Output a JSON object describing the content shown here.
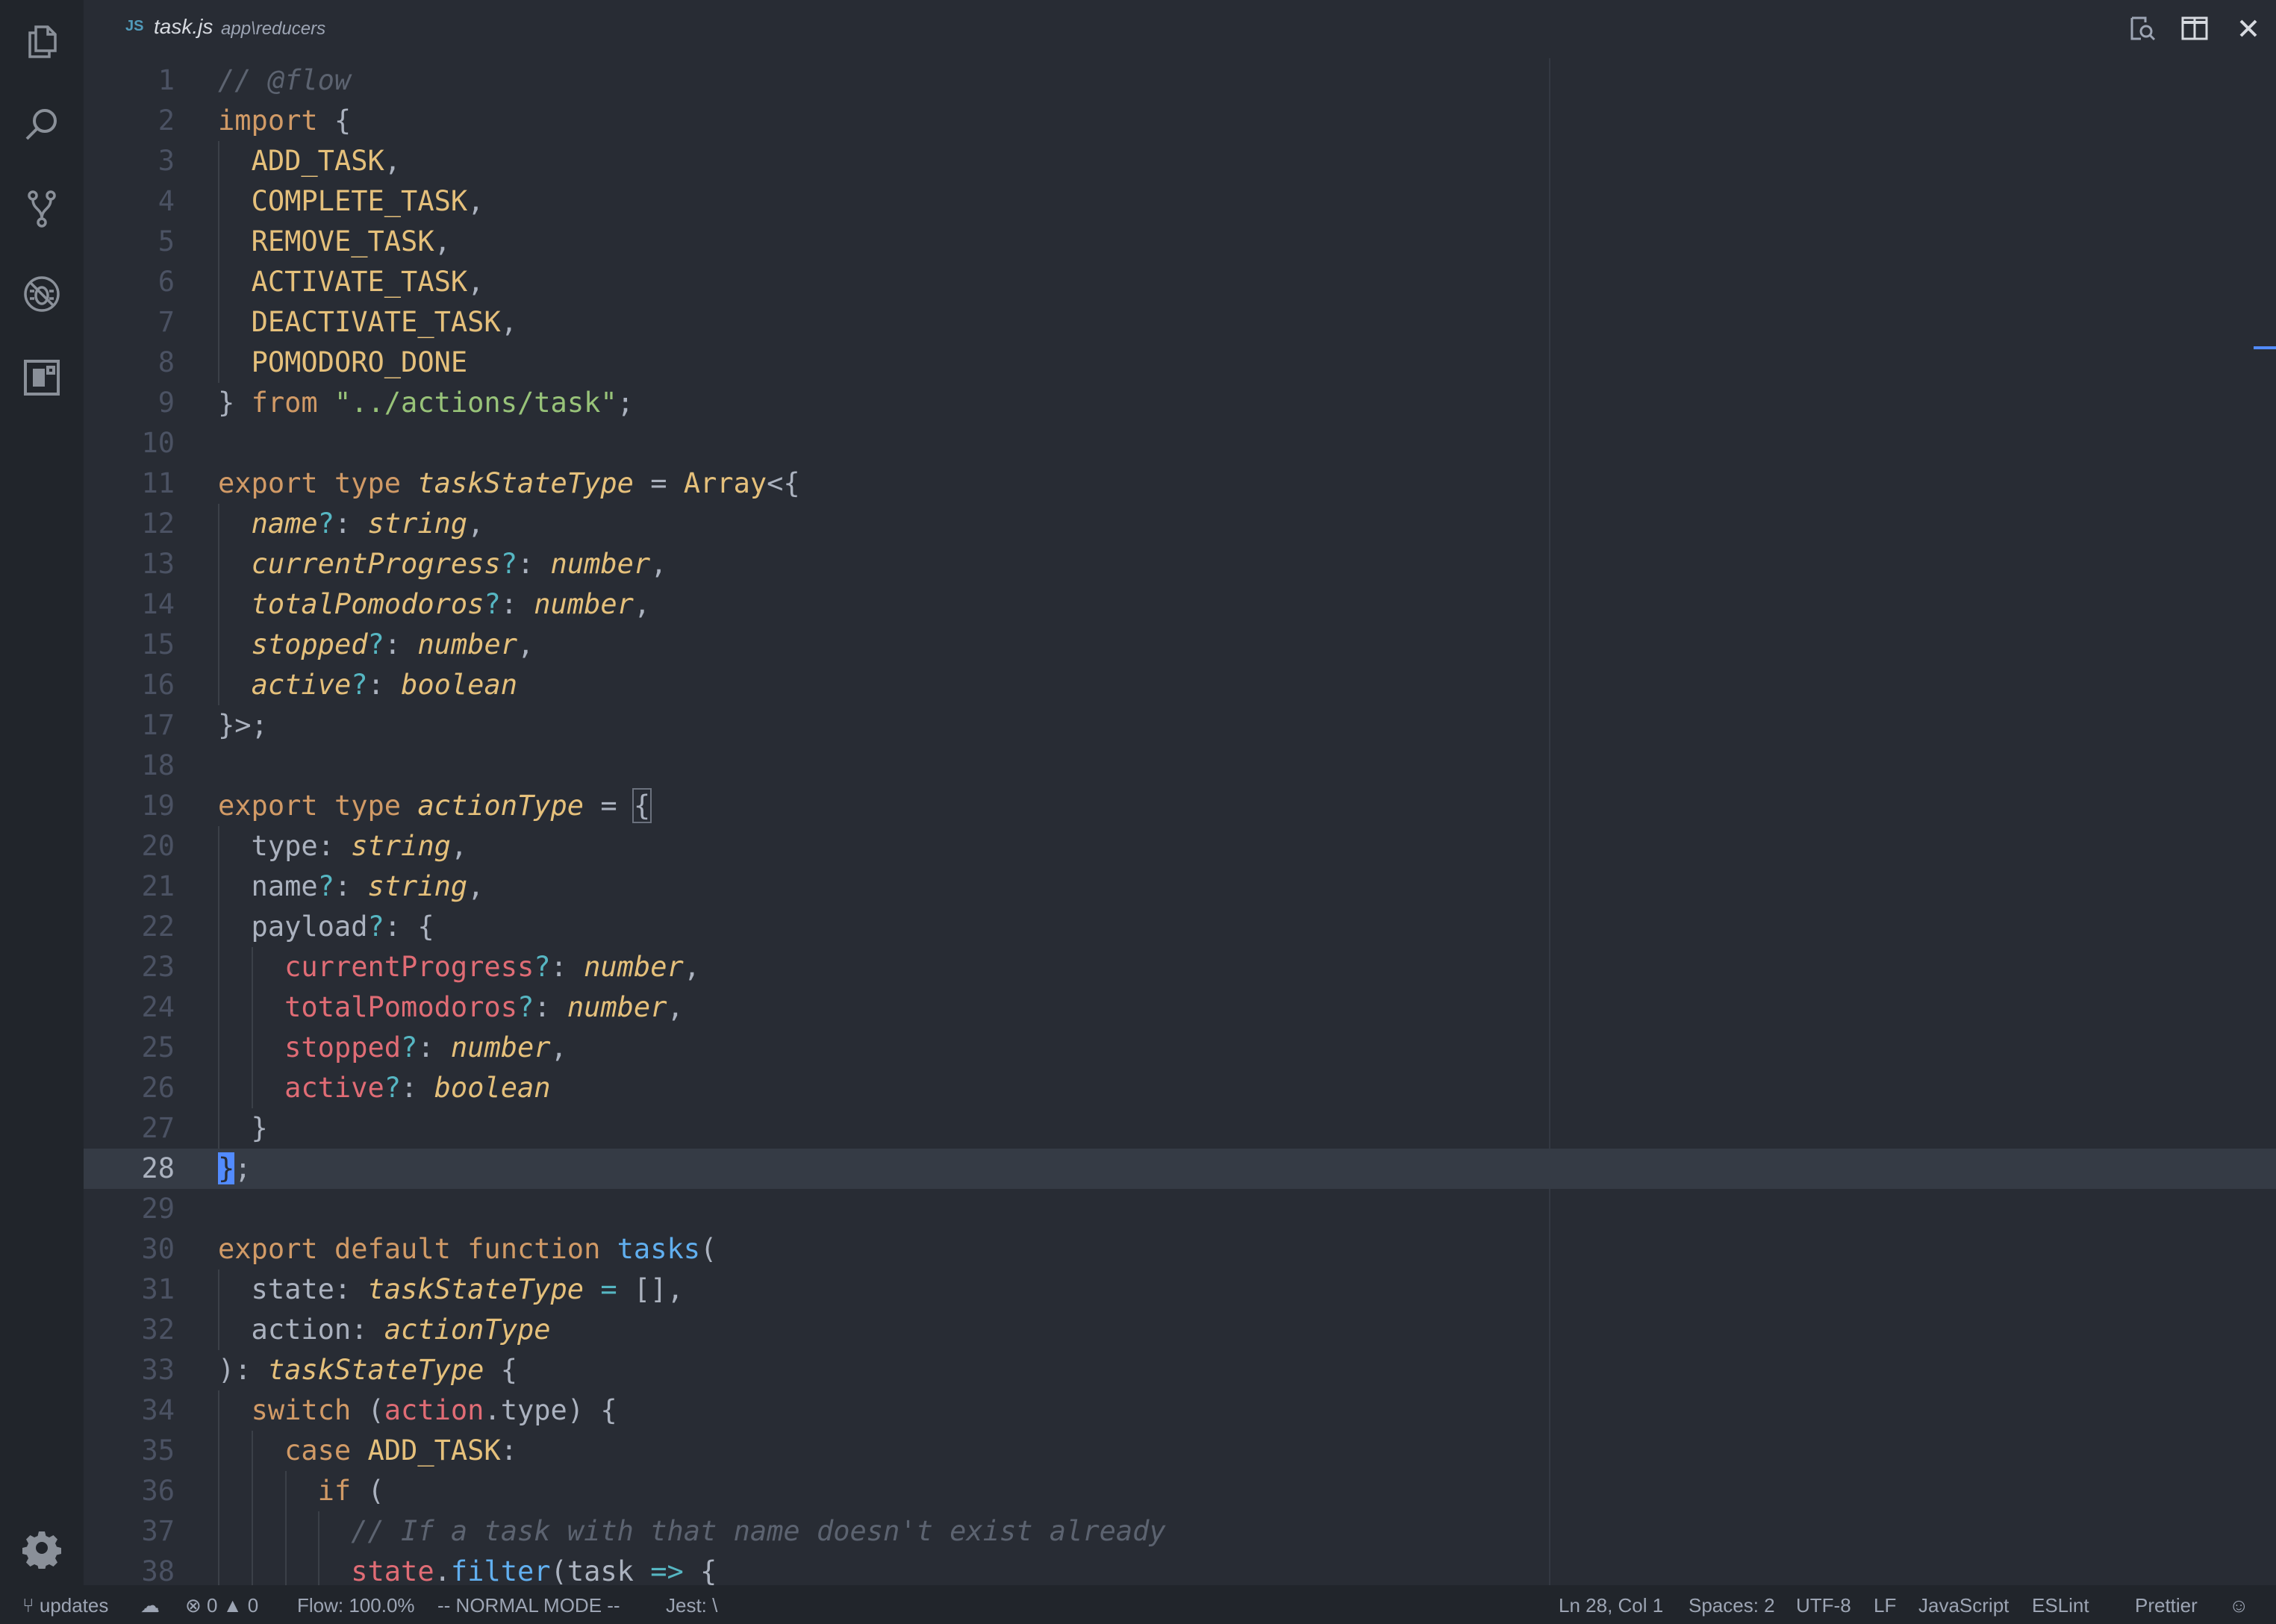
{
  "activity_bar": {
    "icons": [
      "files-icon",
      "search-icon",
      "source-control-icon",
      "debug-icon",
      "extensions-icon",
      "gear-icon"
    ]
  },
  "tab": {
    "language_badge": "JS",
    "filename": "task.js",
    "path": "app\\reducers"
  },
  "title_actions": [
    "open-preview-icon",
    "split-editor-icon",
    "close-icon"
  ],
  "editor": {
    "current_line": 28,
    "lines": [
      {
        "n": "1",
        "tokens": [
          {
            "t": "// @flow",
            "c": "comment"
          }
        ]
      },
      {
        "n": "2",
        "tokens": [
          {
            "t": "import",
            "c": "kw"
          },
          {
            "t": " {",
            "c": "plain"
          }
        ]
      },
      {
        "n": "3",
        "tokens": [
          {
            "t": "  ",
            "c": "plain"
          },
          {
            "t": "ADD_TASK",
            "c": "const"
          },
          {
            "t": ",",
            "c": "plain"
          }
        ]
      },
      {
        "n": "4",
        "tokens": [
          {
            "t": "  ",
            "c": "plain"
          },
          {
            "t": "COMPLETE_TASK",
            "c": "const"
          },
          {
            "t": ",",
            "c": "plain"
          }
        ]
      },
      {
        "n": "5",
        "tokens": [
          {
            "t": "  ",
            "c": "plain"
          },
          {
            "t": "REMOVE_TASK",
            "c": "const"
          },
          {
            "t": ",",
            "c": "plain"
          }
        ]
      },
      {
        "n": "6",
        "tokens": [
          {
            "t": "  ",
            "c": "plain"
          },
          {
            "t": "ACTIVATE_TASK",
            "c": "const"
          },
          {
            "t": ",",
            "c": "plain"
          }
        ]
      },
      {
        "n": "7",
        "tokens": [
          {
            "t": "  ",
            "c": "plain"
          },
          {
            "t": "DEACTIVATE_TASK",
            "c": "const"
          },
          {
            "t": ",",
            "c": "plain"
          }
        ]
      },
      {
        "n": "8",
        "tokens": [
          {
            "t": "  ",
            "c": "plain"
          },
          {
            "t": "POMODORO_DONE",
            "c": "const"
          }
        ]
      },
      {
        "n": "9",
        "tokens": [
          {
            "t": "} ",
            "c": "plain"
          },
          {
            "t": "from",
            "c": "kw"
          },
          {
            "t": " ",
            "c": "plain"
          },
          {
            "t": "\"../actions/task\"",
            "c": "str"
          },
          {
            "t": ";",
            "c": "plain"
          }
        ]
      },
      {
        "n": "10",
        "tokens": []
      },
      {
        "n": "11",
        "tokens": [
          {
            "t": "export",
            "c": "kw"
          },
          {
            "t": " ",
            "c": "plain"
          },
          {
            "t": "type",
            "c": "kw"
          },
          {
            "t": " ",
            "c": "plain"
          },
          {
            "t": "taskStateType",
            "c": "type"
          },
          {
            "t": " = ",
            "c": "plain"
          },
          {
            "t": "Array",
            "c": "const"
          },
          {
            "t": "<{",
            "c": "plain"
          }
        ]
      },
      {
        "n": "12",
        "tokens": [
          {
            "t": "  ",
            "c": "plain"
          },
          {
            "t": "name",
            "c": "prop"
          },
          {
            "t": "?",
            "c": "opt"
          },
          {
            "t": ": ",
            "c": "plain"
          },
          {
            "t": "string",
            "c": "type"
          },
          {
            "t": ",",
            "c": "plain"
          }
        ]
      },
      {
        "n": "13",
        "tokens": [
          {
            "t": "  ",
            "c": "plain"
          },
          {
            "t": "currentProgress",
            "c": "prop"
          },
          {
            "t": "?",
            "c": "opt"
          },
          {
            "t": ": ",
            "c": "plain"
          },
          {
            "t": "number",
            "c": "type"
          },
          {
            "t": ",",
            "c": "plain"
          }
        ]
      },
      {
        "n": "14",
        "tokens": [
          {
            "t": "  ",
            "c": "plain"
          },
          {
            "t": "totalPomodoros",
            "c": "prop"
          },
          {
            "t": "?",
            "c": "opt"
          },
          {
            "t": ": ",
            "c": "plain"
          },
          {
            "t": "number",
            "c": "type"
          },
          {
            "t": ",",
            "c": "plain"
          }
        ]
      },
      {
        "n": "15",
        "tokens": [
          {
            "t": "  ",
            "c": "plain"
          },
          {
            "t": "stopped",
            "c": "prop"
          },
          {
            "t": "?",
            "c": "opt"
          },
          {
            "t": ": ",
            "c": "plain"
          },
          {
            "t": "number",
            "c": "type"
          },
          {
            "t": ",",
            "c": "plain"
          }
        ]
      },
      {
        "n": "16",
        "tokens": [
          {
            "t": "  ",
            "c": "plain"
          },
          {
            "t": "active",
            "c": "prop"
          },
          {
            "t": "?",
            "c": "opt"
          },
          {
            "t": ": ",
            "c": "plain"
          },
          {
            "t": "boolean",
            "c": "type"
          }
        ]
      },
      {
        "n": "17",
        "tokens": [
          {
            "t": "}>;",
            "c": "plain"
          }
        ]
      },
      {
        "n": "18",
        "tokens": []
      },
      {
        "n": "19",
        "tokens": [
          {
            "t": "export",
            "c": "kw"
          },
          {
            "t": " ",
            "c": "plain"
          },
          {
            "t": "type",
            "c": "kw"
          },
          {
            "t": " ",
            "c": "plain"
          },
          {
            "t": "actionType",
            "c": "type"
          },
          {
            "t": " = ",
            "c": "plain"
          },
          {
            "t": "{",
            "c": "bracket"
          }
        ]
      },
      {
        "n": "20",
        "tokens": [
          {
            "t": "  type: ",
            "c": "plain"
          },
          {
            "t": "string",
            "c": "type"
          },
          {
            "t": ",",
            "c": "plain"
          }
        ]
      },
      {
        "n": "21",
        "tokens": [
          {
            "t": "  name",
            "c": "plain"
          },
          {
            "t": "?",
            "c": "opt"
          },
          {
            "t": ": ",
            "c": "plain"
          },
          {
            "t": "string",
            "c": "type"
          },
          {
            "t": ",",
            "c": "plain"
          }
        ]
      },
      {
        "n": "22",
        "tokens": [
          {
            "t": "  payload",
            "c": "plain"
          },
          {
            "t": "?",
            "c": "opt"
          },
          {
            "t": ": {",
            "c": "plain"
          }
        ]
      },
      {
        "n": "23",
        "tokens": [
          {
            "t": "    ",
            "c": "plain"
          },
          {
            "t": "currentProgress",
            "c": "prop2"
          },
          {
            "t": "?",
            "c": "opt"
          },
          {
            "t": ": ",
            "c": "plain"
          },
          {
            "t": "number",
            "c": "type"
          },
          {
            "t": ",",
            "c": "plain"
          }
        ]
      },
      {
        "n": "24",
        "tokens": [
          {
            "t": "    ",
            "c": "plain"
          },
          {
            "t": "totalPomodoros",
            "c": "prop2"
          },
          {
            "t": "?",
            "c": "opt"
          },
          {
            "t": ": ",
            "c": "plain"
          },
          {
            "t": "number",
            "c": "type"
          },
          {
            "t": ",",
            "c": "plain"
          }
        ]
      },
      {
        "n": "25",
        "tokens": [
          {
            "t": "    ",
            "c": "plain"
          },
          {
            "t": "stopped",
            "c": "prop2"
          },
          {
            "t": "?",
            "c": "opt"
          },
          {
            "t": ": ",
            "c": "plain"
          },
          {
            "t": "number",
            "c": "type"
          },
          {
            "t": ",",
            "c": "plain"
          }
        ]
      },
      {
        "n": "26",
        "tokens": [
          {
            "t": "    ",
            "c": "plain"
          },
          {
            "t": "active",
            "c": "prop2"
          },
          {
            "t": "?",
            "c": "opt"
          },
          {
            "t": ": ",
            "c": "plain"
          },
          {
            "t": "boolean",
            "c": "type"
          }
        ]
      },
      {
        "n": "27",
        "tokens": [
          {
            "t": "  }",
            "c": "plain"
          }
        ]
      },
      {
        "n": "28",
        "tokens": [
          {
            "t": "}",
            "c": "cursor"
          },
          {
            "t": ";",
            "c": "plain"
          }
        ]
      },
      {
        "n": "29",
        "tokens": []
      },
      {
        "n": "30",
        "tokens": [
          {
            "t": "export",
            "c": "kw"
          },
          {
            "t": " ",
            "c": "plain"
          },
          {
            "t": "default",
            "c": "kw"
          },
          {
            "t": " ",
            "c": "plain"
          },
          {
            "t": "function",
            "c": "kw"
          },
          {
            "t": " ",
            "c": "plain"
          },
          {
            "t": "tasks",
            "c": "fn"
          },
          {
            "t": "(",
            "c": "plain"
          }
        ]
      },
      {
        "n": "31",
        "tokens": [
          {
            "t": "  state: ",
            "c": "plain"
          },
          {
            "t": "taskStateType",
            "c": "type"
          },
          {
            "t": " = ",
            "c": "opt"
          },
          {
            "t": "[],",
            "c": "plain"
          }
        ]
      },
      {
        "n": "32",
        "tokens": [
          {
            "t": "  action: ",
            "c": "plain"
          },
          {
            "t": "actionType",
            "c": "type"
          }
        ]
      },
      {
        "n": "33",
        "tokens": [
          {
            "t": "): ",
            "c": "plain"
          },
          {
            "t": "taskStateType",
            "c": "type"
          },
          {
            "t": " {",
            "c": "plain"
          }
        ]
      },
      {
        "n": "34",
        "tokens": [
          {
            "t": "  ",
            "c": "plain"
          },
          {
            "t": "switch",
            "c": "kw"
          },
          {
            "t": " (",
            "c": "plain"
          },
          {
            "t": "action",
            "c": "var"
          },
          {
            "t": ".type) {",
            "c": "plain"
          }
        ]
      },
      {
        "n": "35",
        "tokens": [
          {
            "t": "    ",
            "c": "plain"
          },
          {
            "t": "case",
            "c": "kw"
          },
          {
            "t": " ",
            "c": "plain"
          },
          {
            "t": "ADD_TASK",
            "c": "const"
          },
          {
            "t": ":",
            "c": "plain"
          }
        ]
      },
      {
        "n": "36",
        "tokens": [
          {
            "t": "      ",
            "c": "plain"
          },
          {
            "t": "if",
            "c": "kw"
          },
          {
            "t": " (",
            "c": "plain"
          }
        ]
      },
      {
        "n": "37",
        "tokens": [
          {
            "t": "        ",
            "c": "plain"
          },
          {
            "t": "// If a task with that name doesn't exist already",
            "c": "comment"
          }
        ]
      },
      {
        "n": "38",
        "tokens": [
          {
            "t": "        ",
            "c": "plain"
          },
          {
            "t": "state",
            "c": "var"
          },
          {
            "t": ".",
            "c": "plain"
          },
          {
            "t": "filter",
            "c": "fn"
          },
          {
            "t": "(task ",
            "c": "plain"
          },
          {
            "t": "=>",
            "c": "opt"
          },
          {
            "t": " {",
            "c": "plain"
          }
        ]
      }
    ]
  },
  "status_bar": {
    "branch": "updates",
    "errors": "0",
    "warnings": "0",
    "flow": "Flow: 100.0%",
    "vim_mode": "-- NORMAL MODE --",
    "jest": "Jest: \\",
    "cursor_position": "Ln 28, Col 1",
    "indentation": "Spaces: 2",
    "encoding": "UTF-8",
    "line_ending": "LF",
    "language": "JavaScript",
    "linter": "ESLint",
    "formatter": "Prettier"
  }
}
